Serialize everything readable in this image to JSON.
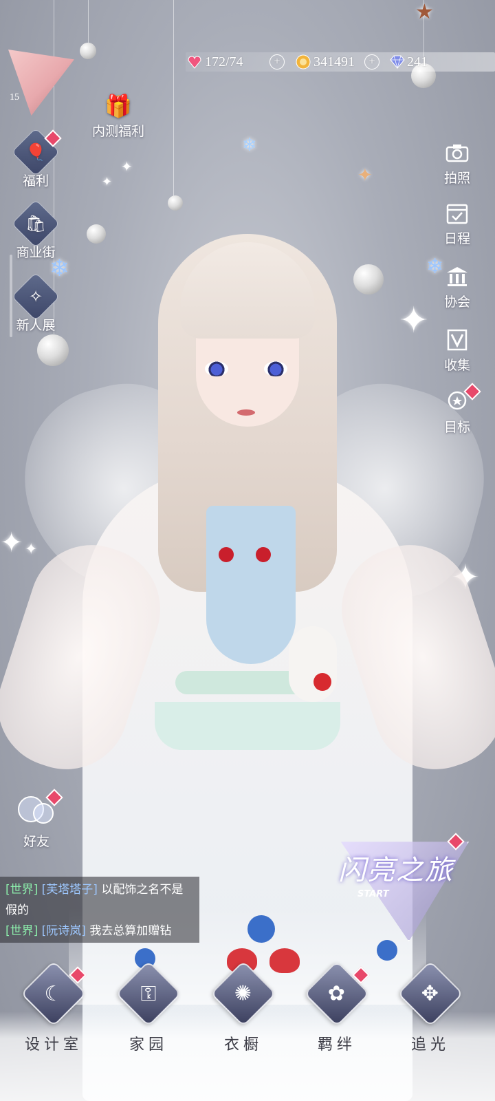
{
  "player": {
    "level": "15"
  },
  "resources": {
    "stamina": "172/74",
    "coins": "341491",
    "diamonds": "241"
  },
  "left_menu": {
    "beta_benefit": "内测福利",
    "welfare": "福利",
    "shop_street": "商业街",
    "newbie_exhibit": "新人展"
  },
  "right_menu": {
    "photo": "拍照",
    "schedule": "日程",
    "association": "协会",
    "collection": "收集",
    "goal": "目标"
  },
  "friends": "好友",
  "chat": [
    {
      "channel": "[世界]",
      "name": "[芙塔塔子]",
      "message": "以配饰之名不是假的"
    },
    {
      "channel": "[世界]",
      "name": "[阮诗岚]",
      "message": "我去总算加赠钻"
    }
  ],
  "event_banner": {
    "title": "闪亮之旅",
    "subtitle": "START"
  },
  "bottom_nav": {
    "design_room": "设计室",
    "home": "家园",
    "wardrobe": "衣橱",
    "bonds": "羁绊",
    "chase_light": "追光"
  },
  "colors": {
    "badge": "#e8486a",
    "chat_channel": "#8df0ad",
    "chat_name": "#9ec8ff"
  },
  "icons": {
    "stamina": "heart-gem-icon",
    "coins": "gold-coin-icon",
    "diamonds": "diamond-icon"
  }
}
